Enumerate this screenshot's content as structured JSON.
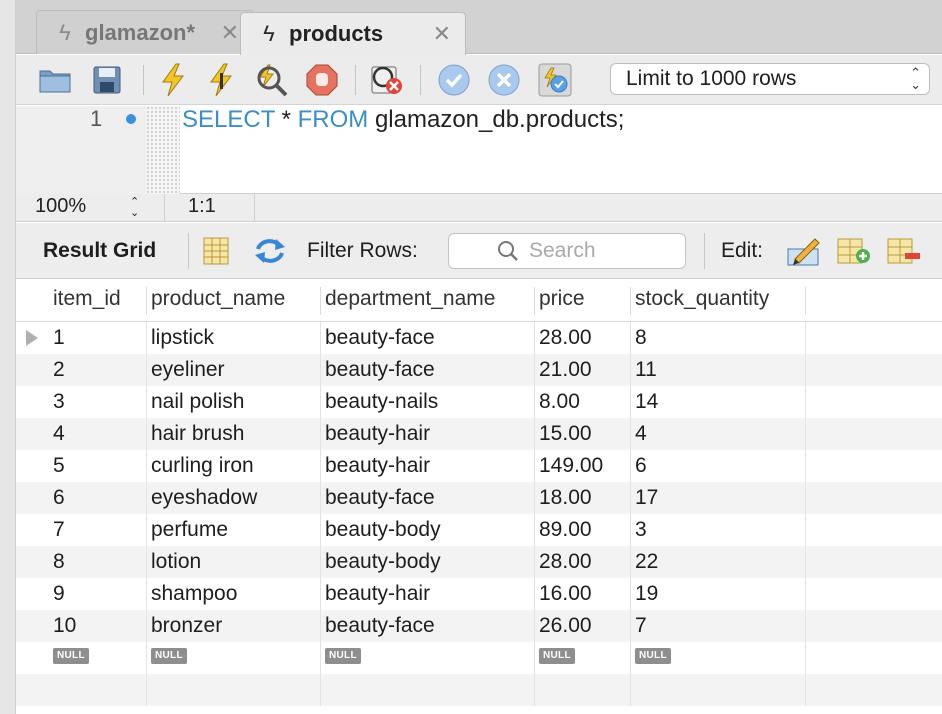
{
  "tabs": [
    {
      "label": "glamazon*",
      "active": false,
      "icon": "lightning-icon"
    },
    {
      "label": "products",
      "active": true,
      "icon": "lightning-icon"
    }
  ],
  "tab_close_glyph": "✕",
  "toolbar": {
    "icons": [
      "open-folder-icon",
      "save-icon",
      "execute-icon",
      "execute-current-icon",
      "explain-icon",
      "stop-icon",
      "toggle-error-icon",
      "commit-icon",
      "rollback-icon",
      "autocommit-icon"
    ],
    "limit_select": {
      "value": "Limit to 1000 rows"
    }
  },
  "editor": {
    "line_number": "1",
    "sql_keyword_1": "SELECT",
    "sql_star": " * ",
    "sql_keyword_2": "FROM",
    "sql_rest": " glamazon_db.products;"
  },
  "status": {
    "zoom": "100%",
    "cursor_position": "1:1"
  },
  "result_toolbar": {
    "title": "Result Grid",
    "filter_label": "Filter Rows:",
    "search_placeholder": "Search",
    "edit_label": "Edit:"
  },
  "grid": {
    "columns": [
      "item_id",
      "product_name",
      "department_name",
      "price",
      "stock_quantity"
    ],
    "rows": [
      [
        "1",
        "lipstick",
        "beauty-face",
        "28.00",
        "8"
      ],
      [
        "2",
        "eyeliner",
        "beauty-face",
        "21.00",
        "11"
      ],
      [
        "3",
        "nail polish",
        "beauty-nails",
        "8.00",
        "14"
      ],
      [
        "4",
        "hair brush",
        "beauty-hair",
        "15.00",
        "4"
      ],
      [
        "5",
        "curling iron",
        "beauty-hair",
        "149.00",
        "6"
      ],
      [
        "6",
        "eyeshadow",
        "beauty-face",
        "18.00",
        "17"
      ],
      [
        "7",
        "perfume",
        "beauty-body",
        "89.00",
        "3"
      ],
      [
        "8",
        "lotion",
        "beauty-body",
        "28.00",
        "22"
      ],
      [
        "9",
        "shampoo",
        "beauty-hair",
        "16.00",
        "19"
      ],
      [
        "10",
        "bronzer",
        "beauty-face",
        "26.00",
        "7"
      ]
    ],
    "null_label": "NULL"
  },
  "colors": {
    "keyword": "#3a8ec9",
    "breakpoint": "#3d8fe0",
    "null_badge": "#8e8e8e"
  }
}
